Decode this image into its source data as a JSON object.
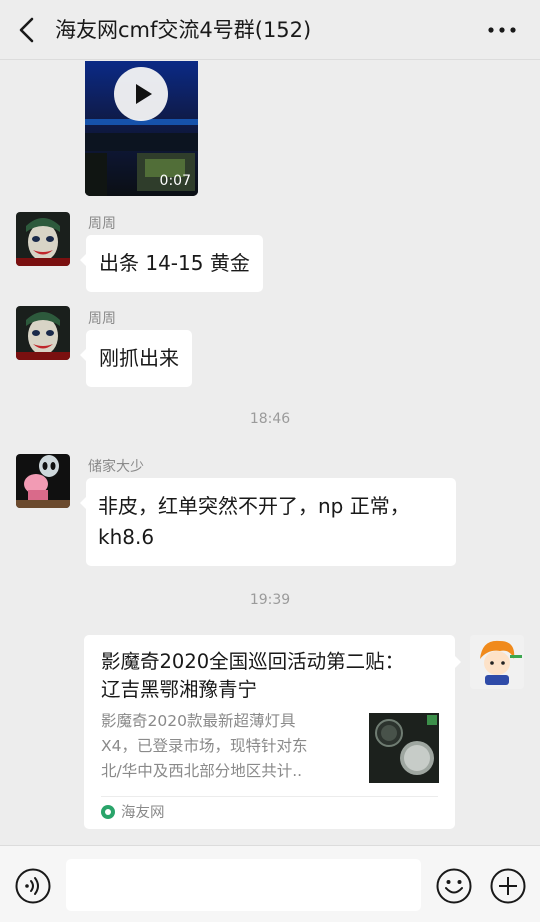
{
  "header": {
    "title": "海友网cmf交流4号群(152)",
    "back_icon": "chevron-left-icon",
    "more_icon": "more-horizontal-icon"
  },
  "messages": [
    {
      "type": "video",
      "duration": "0:07"
    },
    {
      "type": "text",
      "sender": "周周",
      "text": "出条 14-15 黄金"
    },
    {
      "type": "text",
      "sender": "周周",
      "text": "刚抓出来"
    },
    {
      "type": "timestamp",
      "text": "18:46"
    },
    {
      "type": "text",
      "sender": "储家大少",
      "text_line1": "非皮，红单突然不开了，np 正常，",
      "text_line2": "kh8.6"
    },
    {
      "type": "timestamp",
      "text": "19:39"
    },
    {
      "type": "link-card",
      "title": "影魔奇2020全国巡回活动第二贴： 辽吉黑鄂湘豫青宁",
      "desc_line1": "影魔奇2020款最新超薄灯具",
      "desc_line2": "X4，已登录市场，现特针对东",
      "desc_line3": "北/华中及西北部分地区共计..",
      "source": "海友网"
    }
  ],
  "input_bar": {
    "voice_icon": "voice-icon",
    "emoji_icon": "emoji-icon",
    "plus_icon": "plus-circle-icon",
    "placeholder": ""
  },
  "colors": {
    "background": "#ededed",
    "bubble": "#ffffff",
    "meta_text": "#8a8a8a"
  }
}
